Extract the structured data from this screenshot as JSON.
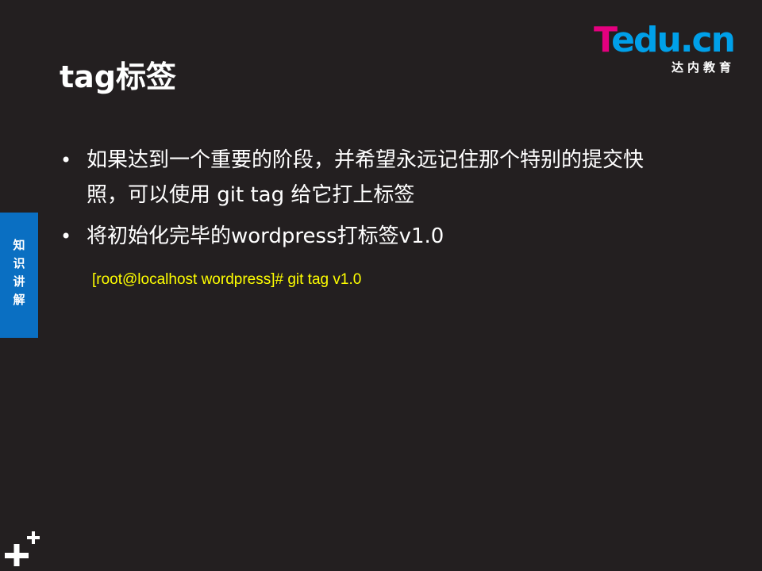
{
  "logo": {
    "letter_t": "T",
    "letters_rest": "edu.cn",
    "subtitle": "达内教育",
    "colors": {
      "t": "#e4007f",
      "rest": "#00a0e9"
    }
  },
  "slide": {
    "title": "tag标签",
    "side_tab_label": "知识讲解",
    "bullets": [
      {
        "symbol": "•",
        "text": "如果达到一个重要的阶段，并希望永远记住那个特别的提交快照，可以使用 git tag 给它打上标签"
      },
      {
        "symbol": "•",
        "text": "将初始化完毕的wordpress打标签v1.0"
      }
    ],
    "command": "[root@localhost wordpress]# git tag v1.0"
  },
  "colors": {
    "background": "#231f20",
    "side_tab": "#0a6fc2",
    "command_text": "#ffff00",
    "text": "#ffffff"
  },
  "icons": {
    "decoration": "plus-icon"
  }
}
